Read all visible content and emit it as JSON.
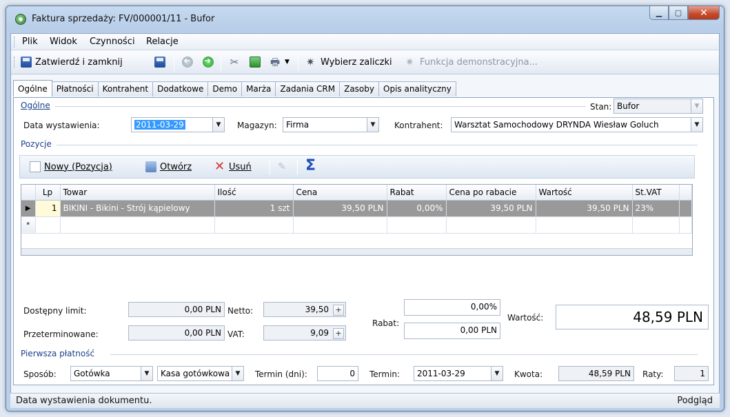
{
  "window": {
    "title": "Faktura sprzedaży: FV/000001/11 - Bufor"
  },
  "menu": [
    {
      "label": "Plik"
    },
    {
      "label": "Widok"
    },
    {
      "label": "Czynności"
    },
    {
      "label": "Relacje"
    }
  ],
  "toolbar": {
    "approve_close": "Zatwierdź i zamknij",
    "choose_advances": "Wybierz zaliczki",
    "demo_function": "Funkcja demonstracyjna..."
  },
  "tabs": [
    "Ogólne",
    "Płatności",
    "Kontrahent",
    "Dodatkowe",
    "Demo",
    "Marża",
    "Zadania CRM",
    "Zasoby",
    "Opis analityczny"
  ],
  "general": {
    "section": "Ogólne",
    "state_label": "Stan:",
    "state_value": "Bufor",
    "issue_date_label": "Data wystawienia:",
    "issue_date_value": "2011-03-29",
    "warehouse_label": "Magazyn:",
    "warehouse_value": "Firma",
    "contractor_label": "Kontrahent:",
    "contractor_value": "Warsztat Samochodowy DRYNDA Wiesław Goluch"
  },
  "items": {
    "section": "Pozycje",
    "new_label": "Nowy (Pozycja)",
    "open_label": "Otwórz",
    "delete_label": "Usuń",
    "columns": [
      "Lp",
      "Towar",
      "Ilość",
      "Cena",
      "Rabat",
      "Cena po rabacie",
      "Wartość",
      "St.VAT"
    ],
    "rows": [
      {
        "lp": "1",
        "towar": "BIKINI - Bikini - Strój kąpielowy",
        "ilosc": "1 szt",
        "cena": "39,50 PLN",
        "rabat": "0,00%",
        "cena_po": "39,50 PLN",
        "wartosc": "39,50 PLN",
        "vat": "23%"
      }
    ],
    "new_row_marker": "*"
  },
  "summary": {
    "limit_label": "Dostępny limit:",
    "limit_value": "0,00 PLN",
    "overdue_label": "Przeterminowane:",
    "overdue_value": "0,00 PLN",
    "net_label": "Netto:",
    "net_value": "39,50",
    "vat_label": "VAT:",
    "vat_value": "9,09",
    "discount_label": "Rabat:",
    "discount_pct": "0,00%",
    "discount_amount": "0,00 PLN",
    "value_label": "Wartość:",
    "value": "48,59 PLN"
  },
  "payment": {
    "section": "Pierwsza płatność",
    "method_label": "Sposób:",
    "method_value": "Gotówka",
    "cashbox_value": "Kasa gotówkowa",
    "days_label": "Termin (dni):",
    "days_value": "0",
    "due_label": "Termin:",
    "due_value": "2011-03-29",
    "amount_label": "Kwota:",
    "amount_value": "48,59 PLN",
    "installments_label": "Raty:",
    "installments_value": "1"
  },
  "status": {
    "hint": "Data wystawienia dokumentu.",
    "mode": "Podgląd"
  },
  "colors": {
    "selected_row": "#999999",
    "accent_blue": "#1a3f8a",
    "highlight": "#3399ff"
  }
}
